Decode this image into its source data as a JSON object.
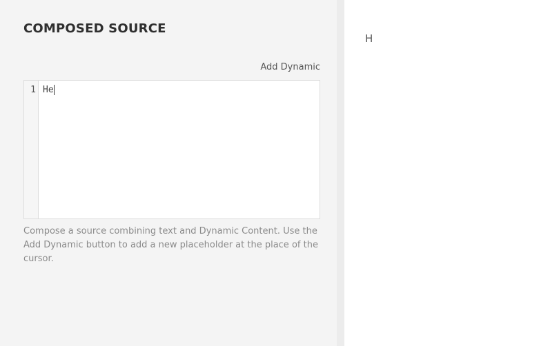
{
  "composer": {
    "title": "COMPOSED SOURCE",
    "add_dynamic_label": "Add Dynamic",
    "editor": {
      "line_numbers": [
        "1"
      ],
      "lines": [
        "He"
      ]
    },
    "help_text": "Compose a source combining text and Dynamic Content. Use the Add Dynamic button to add a new placeholder at the place of the cursor."
  },
  "preview": {
    "text": "H"
  },
  "colors": {
    "left_panel_bg": "#f4f4f4",
    "divider_bg": "#ececec",
    "right_panel_bg": "#ffffff",
    "title_color": "#2f2f2f",
    "help_text_color": "#8a8a8a"
  }
}
